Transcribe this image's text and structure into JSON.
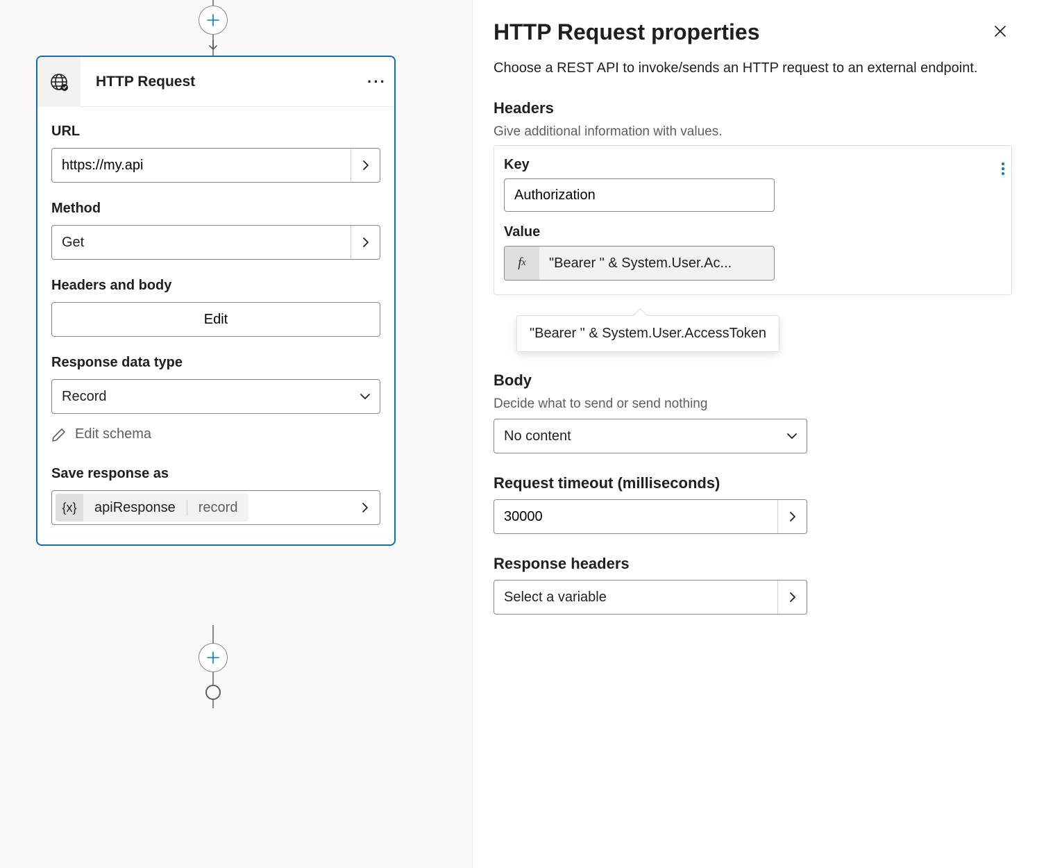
{
  "card": {
    "title": "HTTP Request",
    "url_label": "URL",
    "url_value": "https://my.api",
    "method_label": "Method",
    "method_value": "Get",
    "headers_body_label": "Headers and body",
    "edit_button": "Edit",
    "response_type_label": "Response data type",
    "response_type_value": "Record",
    "edit_schema": "Edit schema",
    "save_as_label": "Save response as",
    "save_as_var": "apiResponse",
    "save_as_type": "record"
  },
  "panel": {
    "title": "HTTP Request properties",
    "description": "Choose a REST API to invoke/sends an HTTP request to an external endpoint.",
    "headers_title": "Headers",
    "headers_help": "Give additional information with values.",
    "key_label": "Key",
    "key_value": "Authorization",
    "value_label": "Value",
    "value_expr_short": "\"Bearer \" & System.User.Ac...",
    "value_expr_full": "\"Bearer \" & System.User.AccessToken",
    "body_title": "Body",
    "body_help": "Decide what to send or send nothing",
    "body_value": "No content",
    "timeout_title": "Request timeout (milliseconds)",
    "timeout_value": "30000",
    "response_headers_title": "Response headers",
    "response_headers_value": "Select a variable"
  }
}
